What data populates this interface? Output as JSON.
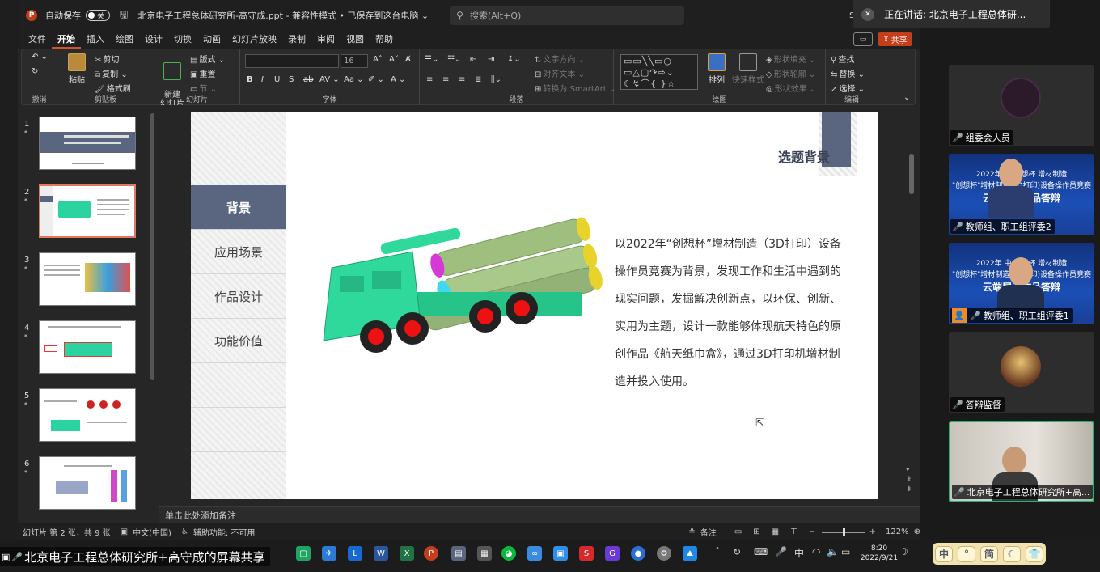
{
  "titlebar": {
    "autosave_label": "自动保存",
    "autosave_state": "关",
    "document_title": "北京电子工程总体研究所-高守成.ppt  -  兼容性模式 • 已保存到这台电脑 ⌄",
    "search_placeholder": "搜索(Alt+Q)",
    "user_name": "SC G",
    "user_initials": "SG"
  },
  "menu": {
    "items": [
      "文件",
      "开始",
      "插入",
      "绘图",
      "设计",
      "切换",
      "动画",
      "幻灯片放映",
      "录制",
      "审阅",
      "视图",
      "帮助"
    ],
    "active": "开始",
    "share_label": "共享"
  },
  "ribbon": {
    "groups": {
      "undo": "撤消",
      "clipboard": "剪贴板",
      "slides": "幻灯片",
      "font": "字体",
      "paragraph": "段落",
      "drawing": "绘图",
      "editing": "编辑"
    },
    "paste": "粘贴",
    "cut": "剪切",
    "copy": "复制",
    "format_painter": "格式刷",
    "new_slide": "新建\n幻灯片",
    "layout": "版式",
    "reset": "重置",
    "section": "节",
    "font_size": "16",
    "text_direction": "文字方向",
    "align_text": "对齐文本",
    "smartart": "转换为 SmartArt",
    "arrange": "排列",
    "quick_styles": "快速样式",
    "shape_fill": "形状填充",
    "shape_outline": "形状轮廓",
    "shape_effects": "形状效果",
    "find": "查找",
    "replace": "替换",
    "select": "选择"
  },
  "thumbnails": {
    "items": [
      {
        "num": "1",
        "star": "*"
      },
      {
        "num": "2",
        "star": "*"
      },
      {
        "num": "3",
        "star": "*"
      },
      {
        "num": "4",
        "star": "*"
      },
      {
        "num": "5",
        "star": "*"
      },
      {
        "num": "6",
        "star": "*"
      }
    ],
    "selected": "2"
  },
  "slide": {
    "title": "选题背景",
    "nav": [
      "背景",
      "应用场景",
      "作品设计",
      "功能价值"
    ],
    "active_nav": "背景",
    "body": "以2022年“创想杯”增材制造（3D打印）设备操作员竞赛为背景，发现工作和生活中遇到的现实问题，发掘解决创新点，以环保、创新、实用为主题，设计一款能够体现航天特色的原创作品《航天纸巾盒》，通过3D打印机增材制造并投入使用。"
  },
  "notes": {
    "placeholder": "单击此处添加备注"
  },
  "statusbar": {
    "slide_info": "幻灯片 第 2 张，共 9 张",
    "language": "中文(中国)",
    "accessibility": "辅助功能: 不可用",
    "notes_label": "备注",
    "zoom": "122%",
    "zoom_fraction": 0.5
  },
  "meeting": {
    "speaking": "正在讲话: 北京电子工程总体研...",
    "tiles": [
      {
        "label": "组委会人员"
      },
      {
        "label": "教师组、职工组评委2",
        "banner_line1": "2022年 中 创想杯 增材制造",
        "banner_line2": "\"创想杯\"增材制造(3D打印)设备操作员竞赛",
        "banner_big": "云端展示作品答辩"
      },
      {
        "label": "教师组、职工组评委1",
        "banner_line1": "2022年 中 创想杯 增材制造",
        "banner_line2": "\"创想杯\"增材制造(3D打印)设备操作员竞赛",
        "banner_big": "云端展示作品答辩"
      },
      {
        "label": "答辩监督"
      },
      {
        "label": "北京电子工程总体研究所+高..."
      }
    ]
  },
  "taskbar": {
    "screen_share": "北京电子工程总体研究所+高守成的屏幕共享",
    "time": "8:20",
    "date": "2022/9/21",
    "ime_input": "中",
    "ime_buttons": [
      "中",
      "°",
      "简",
      "☾",
      "👕"
    ]
  },
  "colors": {
    "accent_ppt": "#c43e1c",
    "slide_nav_active": "#5a6680",
    "active_tile_border": "#1fb36f"
  }
}
